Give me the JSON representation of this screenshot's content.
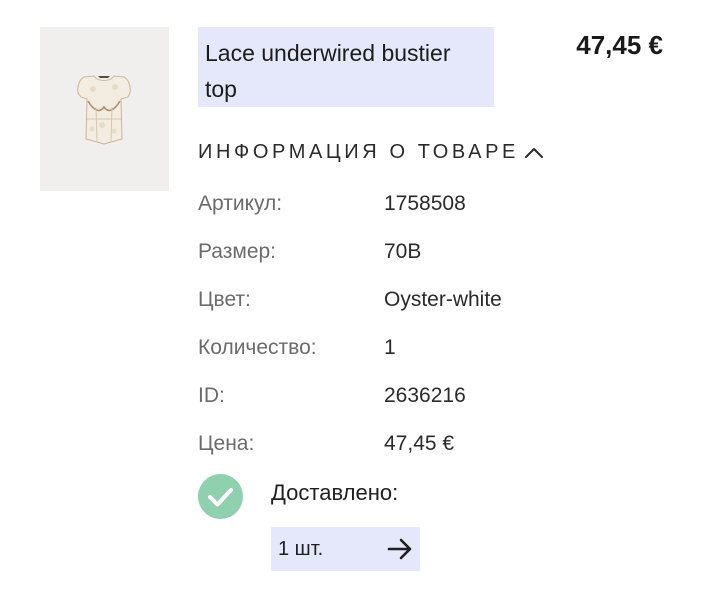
{
  "product": {
    "image_alt_icon": "lace-bustier-top-image",
    "title": "Lace underwired bustier top",
    "price": "47,45 €"
  },
  "info": {
    "header": "ИНФОРМАЦИЯ О ТОВАРЕ",
    "toggle_icon": "chevron-up-icon",
    "rows": [
      {
        "label": "Артикул:",
        "value": "1758508"
      },
      {
        "label": "Размер:",
        "value": "70B"
      },
      {
        "label": "Цвет:",
        "value": "Oyster-white"
      },
      {
        "label": "Количество:",
        "value": "1"
      },
      {
        "label": "ID:",
        "value": "2636216"
      },
      {
        "label": "Цена:",
        "value": "47,45 €"
      }
    ]
  },
  "delivery": {
    "status_icon": "check-circle-icon",
    "status_color": "#8fd1ae",
    "status_label": "Доставлено:",
    "quantity_label": "1 шт.",
    "arrow_icon": "arrow-right-icon"
  },
  "colors": {
    "highlight": "#e5e7fb",
    "muted_label": "#6b6b6b"
  }
}
